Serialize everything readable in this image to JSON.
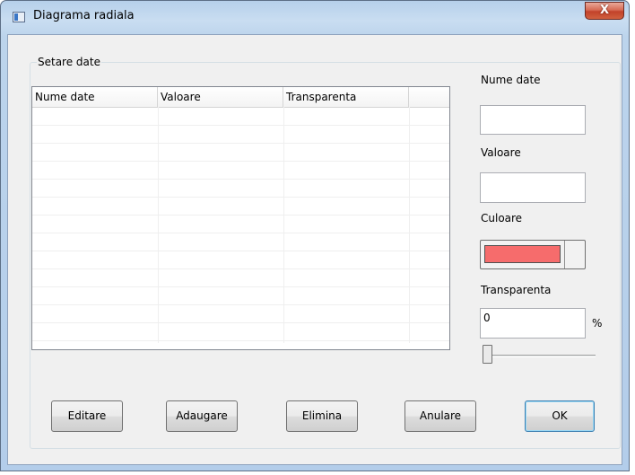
{
  "window": {
    "title": "Diagrama radiala",
    "close_label": "X"
  },
  "group": {
    "legend": "Setare date"
  },
  "list": {
    "columns": [
      "Nume date",
      "Valoare",
      "Transparenta",
      ""
    ],
    "rows": []
  },
  "fields": {
    "name": {
      "label": "Nume date",
      "value": ""
    },
    "value": {
      "label": "Valoare",
      "value": ""
    },
    "color": {
      "label": "Culoare",
      "value": "#f66c6c"
    },
    "transparency": {
      "label": "Transparenta",
      "value": "0",
      "unit": "%"
    }
  },
  "slider": {
    "value": 0
  },
  "buttons": {
    "edit": "Editare",
    "add": "Adaugare",
    "delete": "Elimina",
    "cancel": "Anulare",
    "ok": "OK"
  }
}
